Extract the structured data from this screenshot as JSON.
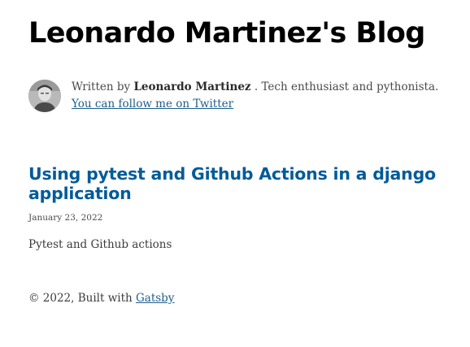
{
  "site": {
    "title": "Leonardo Martinez's Blog"
  },
  "bio": {
    "prefix": "Written by ",
    "author": "Leonardo Martinez",
    "description": " . Tech enthusiast and pythonista. ",
    "link_text": "You can follow me on Twitter",
    "avatar_icon": "author-avatar"
  },
  "posts": [
    {
      "title": "Using pytest and Github Actions in a django application",
      "date": "January 23, 2022",
      "excerpt": "Pytest and Github actions"
    }
  ],
  "footer": {
    "prefix": "© 2022, Built with ",
    "link_text": "Gatsby"
  },
  "colors": {
    "link": "#1f5f8b",
    "post_title": "#005b99",
    "text": "#3b3b3b"
  }
}
